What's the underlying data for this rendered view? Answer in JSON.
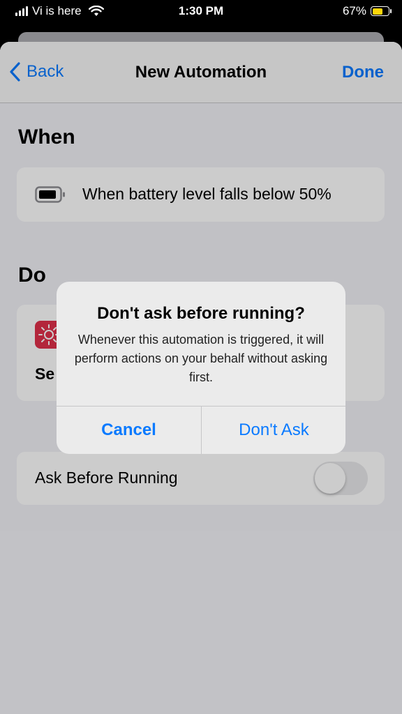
{
  "status_bar": {
    "carrier": "Vi is here",
    "time": "1:30 PM",
    "battery_percent": "67%"
  },
  "nav": {
    "back_label": "Back",
    "title": "New Automation",
    "done_label": "Done"
  },
  "when": {
    "section_title": "When",
    "trigger_text": "When battery level falls below 50%"
  },
  "do": {
    "section_title": "Do",
    "action_text_visible": "Se"
  },
  "ask_before_running": {
    "label": "Ask Before Running",
    "toggle_on": false
  },
  "alert": {
    "title": "Don't ask before running?",
    "message": "Whenever this automation is triggered, it will perform actions on your behalf without asking first.",
    "cancel_label": "Cancel",
    "confirm_label": "Don't Ask"
  },
  "colors": {
    "accent": "#0a7aff",
    "action_icon_bg": "#e0304a",
    "battery_fill": "#ffd60a"
  }
}
